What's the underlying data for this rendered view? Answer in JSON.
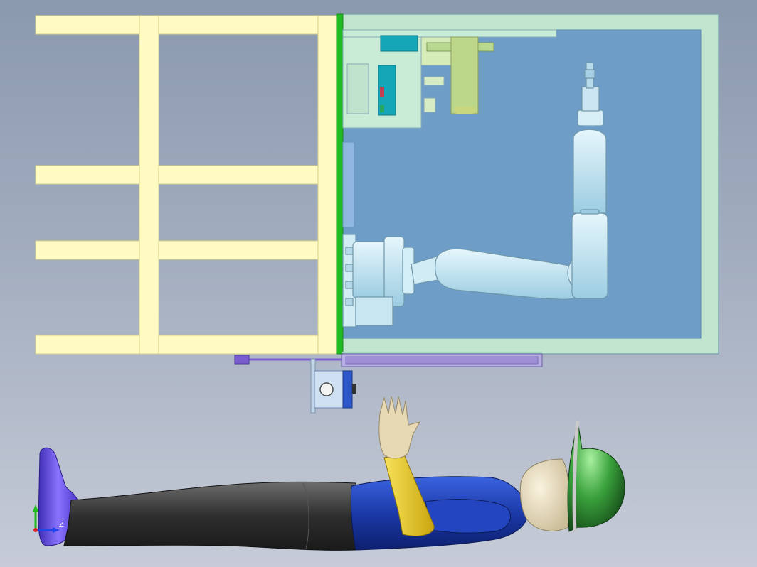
{
  "viewport": {
    "background_top": "#8b99ae",
    "background_bottom": "#c6cbd7"
  },
  "model": {
    "frame_color": "#fffbc2",
    "enclosure_color": "#c2e5d0",
    "enclosure_floor_color": "#6e9ec8",
    "wall_color": "#22bb22",
    "robot_color": "#bfe3f2",
    "slide_rail_color": "#9f8fd6",
    "motor_box_color": "#2c55c8",
    "figure_parts": {
      "shoe": "#6a4fe0",
      "legs": "#3a3a3a",
      "torso": "#1e3ea8",
      "arm": "#e5c51a",
      "hand": "#e8d9b5",
      "head": "#ece0c4",
      "helmet": "#36a03a"
    }
  },
  "triad": {
    "z_label": "Z",
    "y_color": "#22bb22",
    "z_color": "#2244ee",
    "x_color": "#dd2222"
  }
}
